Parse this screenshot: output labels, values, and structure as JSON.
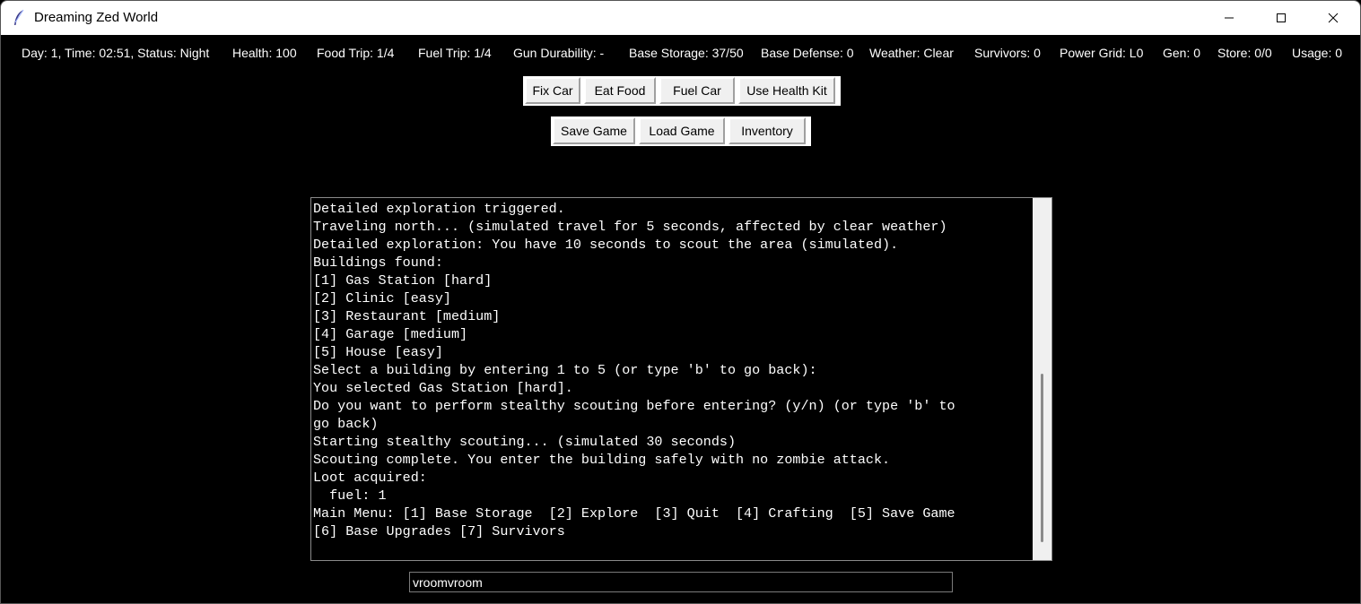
{
  "window": {
    "title": "Dreaming Zed World",
    "app_icon": "feather-icon",
    "controls": [
      "minimize-icon",
      "maximize-icon",
      "close-icon"
    ]
  },
  "status": {
    "day_time": "Day: 1, Time: 02:51, Status: Night",
    "health": "Health: 100",
    "food_trip": "Food Trip: 1/4",
    "fuel_trip": "Fuel Trip: 1/4",
    "gun_durability": "Gun Durability: -",
    "base_storage": "Base Storage: 37/50",
    "base_defense": "Base Defense: 0",
    "weather": "Weather: Clear",
    "survivors": "Survivors: 0",
    "power_grid": "Power Grid: L0",
    "gen": "Gen: 0",
    "store": "Store: 0/0",
    "usage": "Usage: 0"
  },
  "actions": {
    "fix_car": "Fix Car",
    "eat_food": "Eat Food",
    "fuel_car": "Fuel Car",
    "use_health_kit": "Use Health Kit",
    "save_game": "Save Game",
    "load_game": "Load Game",
    "inventory": "Inventory"
  },
  "log": {
    "lines": [
      "Detailed exploration triggered.",
      "Traveling north... (simulated travel for 5 seconds, affected by clear weather)",
      "Detailed exploration: You have 10 seconds to scout the area (simulated).",
      "Buildings found:",
      "[1] Gas Station [hard]",
      "[2] Clinic [easy]",
      "[3] Restaurant [medium]",
      "[4] Garage [medium]",
      "[5] House [easy]",
      "Select a building by entering 1 to 5 (or type 'b' to go back):",
      "You selected Gas Station [hard].",
      "Do you want to perform stealthy scouting before entering? (y/n) (or type 'b' to",
      "go back)",
      "Starting stealthy scouting... (simulated 30 seconds)",
      "Scouting complete. You enter the building safely with no zombie attack.",
      "Loot acquired:",
      "  fuel: 1",
      "Main Menu: [1] Base Storage  [2] Explore  [3] Quit  [4] Crafting  [5] Save Game",
      "[6] Base Upgrades [7] Survivors"
    ]
  },
  "command": {
    "value": "vroomvroom"
  }
}
